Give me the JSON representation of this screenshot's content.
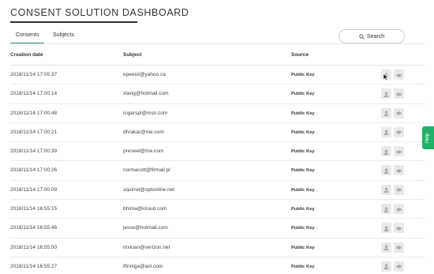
{
  "header": {
    "title": "CONSENT SOLUTION DASHBOARD"
  },
  "tabs": [
    {
      "label": "Consents",
      "active": true
    },
    {
      "label": "Subjects",
      "active": false
    }
  ],
  "search": {
    "label": "Search",
    "icon": "search-icon"
  },
  "table": {
    "columns": [
      "Creation date",
      "Subject",
      "Source"
    ],
    "rows": [
      {
        "date": "2018/11/14 17:05:37",
        "subject": "epeeist@yahoo.ca",
        "source": "Public Key"
      },
      {
        "date": "2018/11/14 17:00:14",
        "subject": "xtang@hotmail.com",
        "source": "Public Key"
      },
      {
        "date": "2018/11/14 17:00:48",
        "subject": "rogerspl@msn.com",
        "source": "Public Key"
      },
      {
        "date": "2018/11/14 17:00:21",
        "subject": "dhrakar@me.com",
        "source": "Public Key"
      },
      {
        "date": "2018/11/14 17:00:39",
        "subject": "preneel@me.com",
        "source": "Public Key"
      },
      {
        "date": "2018/11/14 17:00:26",
        "subject": "normacott@firmail.pl",
        "source": "Public Key"
      },
      {
        "date": "2018/11/14 17:00:09",
        "subject": "squirrel@optonline.net",
        "source": "Public Key"
      },
      {
        "date": "2018/11/14 16:55:15",
        "subject": "bhima@icloud.com",
        "source": "Public Key"
      },
      {
        "date": "2018/11/14 16:55:46",
        "subject": "jesse@hotmail.com",
        "source": "Public Key"
      },
      {
        "date": "2018/11/14 16:55:00",
        "subject": "mxloan@verizon.net",
        "source": "Public Key"
      },
      {
        "date": "2018/11/14 16:55:27",
        "subject": "tfinniga@aol.com",
        "source": "Public Key"
      }
    ],
    "row_actions": [
      "person-icon",
      "eye-icon"
    ]
  },
  "help": {
    "label": "Help"
  },
  "colors": {
    "accent": "#2e8b7a",
    "help": "#1fb36a",
    "action_bg": "#e9e9e9"
  }
}
